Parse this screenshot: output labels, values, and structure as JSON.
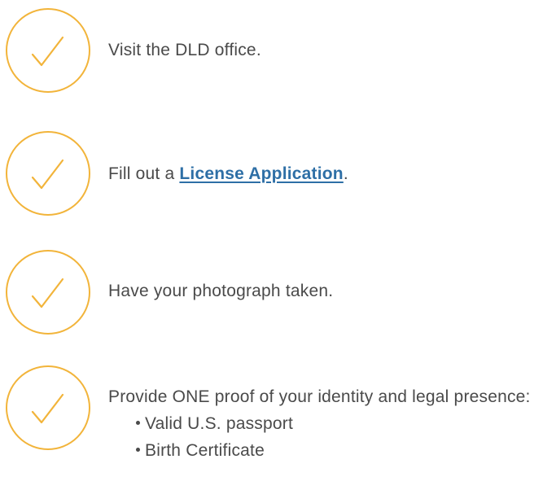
{
  "steps": [
    {
      "icon": "checkmark-circle-icon",
      "text": "Visit the DLD office."
    },
    {
      "icon": "checkmark-circle-icon",
      "text_before": "Fill out a ",
      "link_text": "License Application",
      "text_after": "."
    },
    {
      "icon": "checkmark-circle-icon",
      "text": "Have your photograph taken."
    },
    {
      "icon": "checkmark-circle-icon",
      "text": "Provide ONE proof of your identity and legal presence:",
      "bullets": [
        "Valid U.S. passport",
        "Birth Certificate"
      ]
    }
  ],
  "colors": {
    "accent": "#f2b43a",
    "text": "#4a4a4a",
    "link": "#2e6fa6"
  }
}
